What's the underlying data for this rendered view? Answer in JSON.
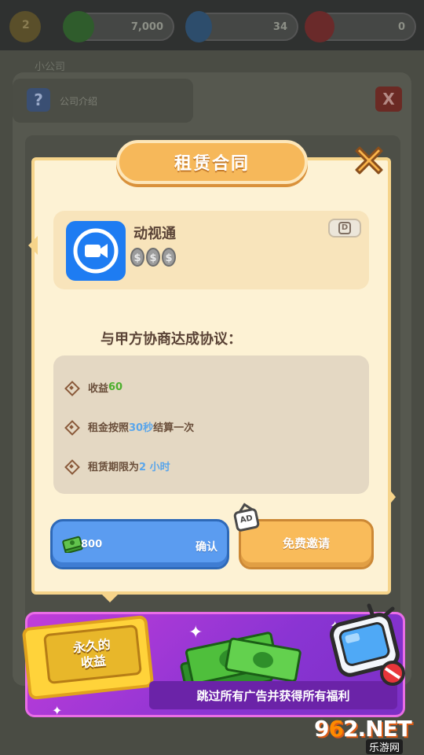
{
  "background": {
    "hud_values": [
      "2",
      "7,000",
      "34",
      "0"
    ],
    "office_label": "小公司",
    "intro_label": "公司介绍",
    "help_icon_label": "?",
    "close_label": "X"
  },
  "dialog": {
    "title": "租赁合同",
    "app": {
      "name": "动视通",
      "rating_coins": 3,
      "badge_label": "D"
    },
    "agree_text": "与甲方协商达成协议：",
    "terms": [
      {
        "prefix": "收益",
        "highlight": "60",
        "suffix": "",
        "highlight_color": "green"
      },
      {
        "prefix": "租金按照",
        "highlight": "30秒",
        "suffix": "结算一次",
        "highlight_color": "blue"
      },
      {
        "prefix": "租赁期限为",
        "highlight": "2 小时",
        "suffix": "",
        "highlight_color": "blue"
      }
    ],
    "confirm_button": {
      "cost": "800",
      "label": "确认"
    },
    "invite_button": {
      "label": "免费邀请",
      "ad_tag": "AD"
    }
  },
  "banner": {
    "ticket_line1": "永久的",
    "ticket_line2": "收益",
    "strip_text": "跳过所有广告并获得所有福利"
  },
  "watermark": {
    "main_prefix": "9",
    "main_o": "6",
    "main_suffix": "2.NET",
    "sub": "乐游网"
  },
  "colors": {
    "title_tab": "#f6b85a",
    "dialog_bg": "#fdf2d4",
    "confirm_blue": "#5b9cf0",
    "invite_orange": "#f9bb5a",
    "highlight_green": "#4caf2d",
    "highlight_blue": "#5ba6ea",
    "banner_purple": "#8a34d3"
  },
  "icons": [
    "coin-icon",
    "video-camera-icon",
    "close-icon",
    "cash-icon",
    "tv-icon",
    "sparkle-icon",
    "diamond-bullet-icon"
  ]
}
